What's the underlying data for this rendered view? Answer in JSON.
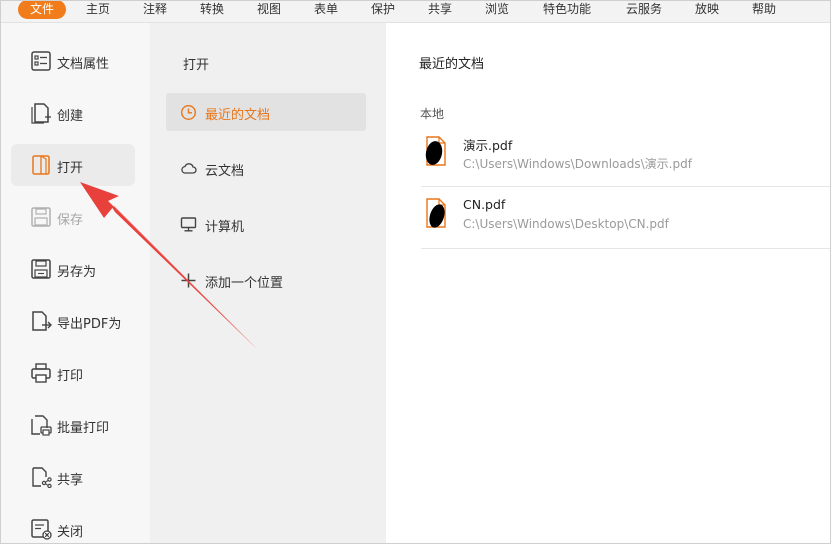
{
  "menubar": {
    "items": [
      "文件",
      "主页",
      "注释",
      "转换",
      "视图",
      "表单",
      "保护",
      "共享",
      "浏览",
      "特色功能",
      "云服务",
      "放映",
      "帮助"
    ],
    "active_index": 0
  },
  "colors": {
    "accent": "#f07c1b",
    "arrow": "#e8413c"
  },
  "left_nav": {
    "items": [
      {
        "label": "文档属性",
        "icon": "document-properties-icon"
      },
      {
        "label": "创建",
        "icon": "create-document-icon"
      },
      {
        "label": "打开",
        "icon": "open-folder-icon",
        "active": true
      },
      {
        "label": "保存",
        "icon": "save-icon",
        "disabled": true
      },
      {
        "label": "另存为",
        "icon": "save-as-icon"
      },
      {
        "label": "导出PDF为",
        "icon": "export-pdf-icon"
      },
      {
        "label": "打印",
        "icon": "printer-icon"
      },
      {
        "label": "批量打印",
        "icon": "batch-print-icon"
      },
      {
        "label": "共享",
        "icon": "share-icon"
      },
      {
        "label": "关闭",
        "icon": "close-document-icon"
      }
    ]
  },
  "open_panel": {
    "heading": "打开",
    "locations": [
      {
        "label": "最近的文档",
        "icon": "clock-icon",
        "active": true
      },
      {
        "label": "云文档",
        "icon": "cloud-icon"
      },
      {
        "label": "计算机",
        "icon": "computer-icon"
      },
      {
        "label": "添加一个位置",
        "icon": "plus-icon"
      }
    ]
  },
  "recent": {
    "title": "最近的文档",
    "section": "本地",
    "files": [
      {
        "name": "演示.pdf",
        "path": "C:\\Users\\Windows\\Downloads\\演示.pdf"
      },
      {
        "name": "CN.pdf",
        "path": "C:\\Users\\Windows\\Desktop\\CN.pdf"
      }
    ]
  }
}
